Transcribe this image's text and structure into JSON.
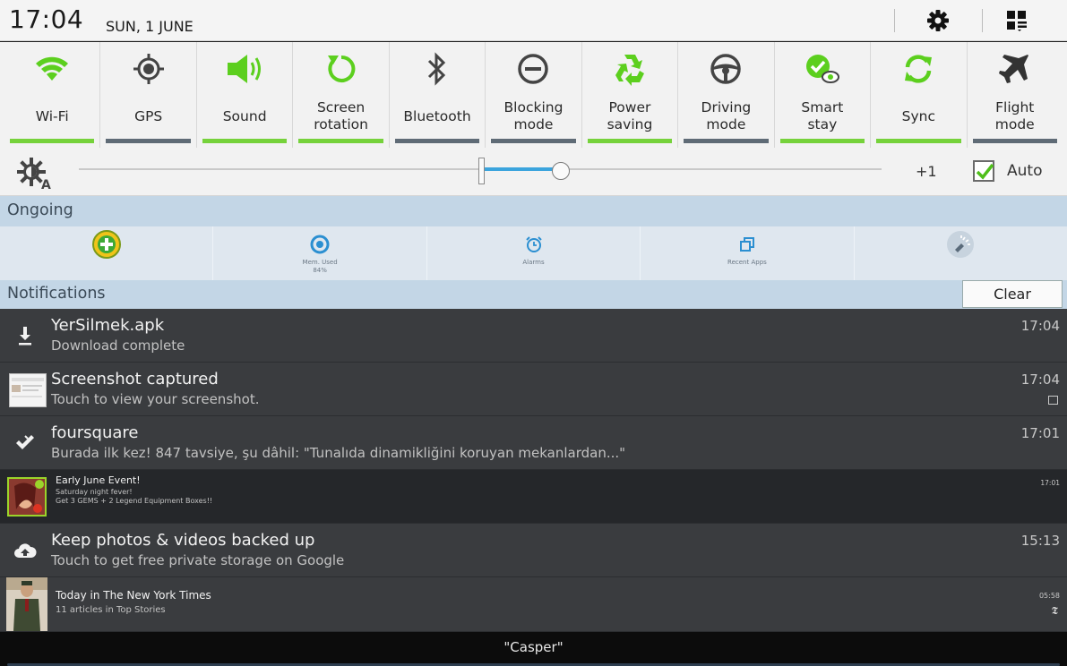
{
  "status_bar": {
    "time": "17:04",
    "date": "SUN, 1 JUNE",
    "settings_icon": "gear-icon",
    "edit_icon": "grid-edit-icon"
  },
  "toggles": [
    {
      "label": "Wi-Fi",
      "icon": "wifi-icon",
      "on": true
    },
    {
      "label": "GPS",
      "icon": "gps-icon",
      "on": false
    },
    {
      "label": "Sound",
      "icon": "sound-icon",
      "on": true
    },
    {
      "label": "Screen\nrotation",
      "icon": "rotation-icon",
      "on": true
    },
    {
      "label": "Bluetooth",
      "icon": "bluetooth-icon",
      "on": false
    },
    {
      "label": "Blocking\nmode",
      "icon": "blocking-icon",
      "on": false
    },
    {
      "label": "Power\nsaving",
      "icon": "recycle-icon",
      "on": true
    },
    {
      "label": "Driving\nmode",
      "icon": "steering-wheel-icon",
      "on": false
    },
    {
      "label": "Smart\nstay",
      "icon": "smart-stay-icon",
      "on": true
    },
    {
      "label": "Sync",
      "icon": "sync-icon",
      "on": true
    },
    {
      "label": "Flight\nmode",
      "icon": "airplane-icon",
      "on": false
    }
  ],
  "brightness": {
    "value_label": "+1",
    "auto_label": "Auto",
    "auto_checked": true,
    "level": 0.59
  },
  "ongoing": {
    "title": "Ongoing",
    "items": [
      {
        "label": "",
        "icon": "cleaner-icon"
      },
      {
        "label": "Mem. Used\n84%",
        "icon": "memory-icon"
      },
      {
        "label": "Alarms",
        "icon": "alarm-icon"
      },
      {
        "label": "Recent Apps",
        "icon": "recent-apps-icon"
      },
      {
        "label": "",
        "icon": "flashlight-icon"
      }
    ]
  },
  "notifications": {
    "title": "Notifications",
    "clear_label": "Clear",
    "items": [
      {
        "title": "YerSilmek.apk",
        "subtitle": "Download complete",
        "time": "17:04",
        "icon": "download-icon"
      },
      {
        "title": "Screenshot captured",
        "subtitle": "Touch to view your screenshot.",
        "time": "17:04",
        "icon": "screenshot-thumbnail"
      },
      {
        "title": "foursquare",
        "subtitle": "Burada ilk kez! 847 tavsiye, şu dâhil: \"Tunalıda dinamikliğini koruyan mekanlardan...\"",
        "time": "17:01",
        "icon": "foursquare-icon"
      },
      {
        "title": "Early June Event!",
        "subtitle": "Saturday night fever!\nGet 3 GEMS + 2 Legend Equipment Boxes!!",
        "time": "17:01",
        "icon": "game-avatar-icon"
      },
      {
        "title": "Keep photos & videos backed up",
        "subtitle": "Touch to get free private storage on Google",
        "time": "15:13",
        "icon": "cloud-upload-icon"
      },
      {
        "title": "Today in The New York Times",
        "subtitle": "11 articles in Top Stories",
        "time": "05:58",
        "icon": "nyt-thumbnail"
      }
    ]
  },
  "carrier": "\"Casper\"",
  "colors": {
    "toggle_on": "#76d23b",
    "toggle_off": "#5f6b76",
    "accent_blue": "#3ba4dd",
    "notification_bg": "#3a3c3f"
  }
}
